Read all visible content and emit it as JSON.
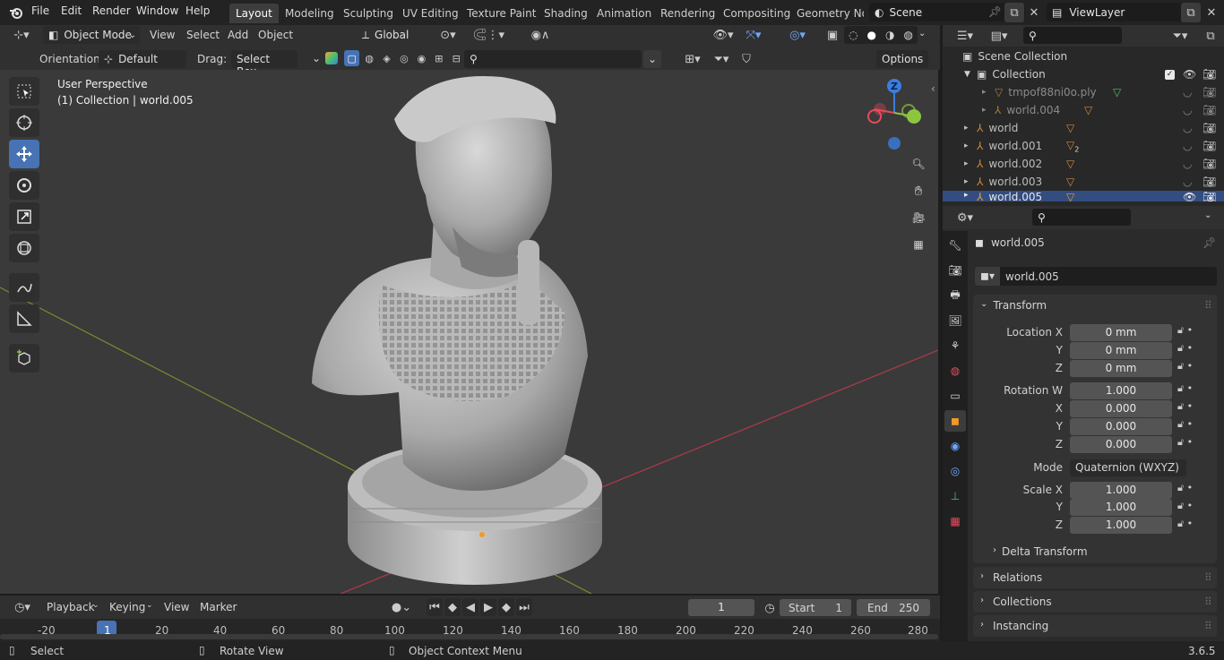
{
  "topbar": {
    "menus": [
      "File",
      "Edit",
      "Render",
      "Window",
      "Help"
    ],
    "workspaces": [
      "Layout",
      "Modeling",
      "Sculpting",
      "UV Editing",
      "Texture Paint",
      "Shading",
      "Animation",
      "Rendering",
      "Compositing",
      "Geometry Noc"
    ],
    "scene": "Scene",
    "view_layer": "ViewLayer"
  },
  "viewport_header": {
    "mode": "Object Mode",
    "menus": [
      "View",
      "Select",
      "Add",
      "Object"
    ],
    "transform_orientation": "Global",
    "orientation_label": "Orientation:",
    "orientation_value": "Default",
    "drag_label": "Drag:",
    "drag_value": "Select Box",
    "options": "Options"
  },
  "viewport": {
    "view_name": "User Perspective",
    "context": "(1) Collection | world.005",
    "gizmo_z": "Z"
  },
  "outliner": {
    "root": "Scene Collection",
    "items": [
      {
        "label": "Collection",
        "indent": 0
      },
      {
        "label": "tmpof88ni0o.ply",
        "indent": 1
      },
      {
        "label": "world.004",
        "indent": 1
      },
      {
        "label": "world",
        "indent": 0
      },
      {
        "label": "world.001",
        "indent": 0,
        "badge": "2"
      },
      {
        "label": "world.002",
        "indent": 0
      },
      {
        "label": "world.003",
        "indent": 0
      },
      {
        "label": "world.005",
        "indent": 0
      }
    ]
  },
  "properties": {
    "object_name": "world.005",
    "datablock_name": "world.005",
    "transform_title": "Transform",
    "location": {
      "label": "Location X",
      "x": "0 mm",
      "y": "0 mm",
      "z": "0 mm"
    },
    "rotation": {
      "label": "Rotation W",
      "w": "1.000",
      "x": "0.000",
      "y": "0.000",
      "z": "0.000"
    },
    "mode_label": "Mode",
    "mode_value": "Quaternion (WXYZ)",
    "scale": {
      "label": "Scale X",
      "x": "1.000",
      "y": "1.000",
      "z": "1.000"
    },
    "axis_y": "Y",
    "axis_z": "Z",
    "axis_x": "X",
    "delta_transform": "Delta Transform",
    "sections": [
      "Relations",
      "Collections",
      "Instancing"
    ]
  },
  "timeline": {
    "menus": [
      "Playback",
      "Keying",
      "View",
      "Marker"
    ],
    "current_frame": "1",
    "start_label": "Start",
    "start_value": "1",
    "end_label": "End",
    "end_value": "250",
    "ticks": [
      "-20",
      "1",
      "20",
      "40",
      "60",
      "80",
      "100",
      "120",
      "140",
      "160",
      "180",
      "200",
      "220",
      "240",
      "260",
      "280"
    ]
  },
  "statusbar": {
    "select": "Select",
    "rotate": "Rotate View",
    "context_menu": "Object Context Menu",
    "version": "3.6.5"
  },
  "colors": {
    "accent": "#4772b3",
    "x_axis": "#e84b5e",
    "y_axis": "#8cc63f",
    "z_axis": "#3a7ee0",
    "outliner_obj": "#d08a3c"
  }
}
